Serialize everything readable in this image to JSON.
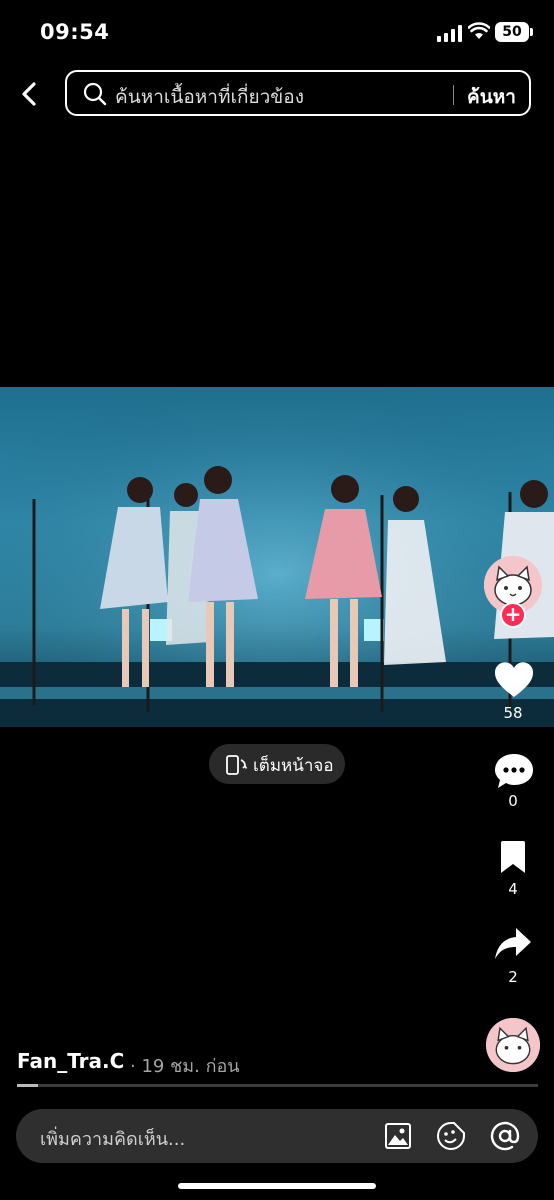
{
  "status_bar": {
    "time": "09:54",
    "battery": "50"
  },
  "search": {
    "placeholder": "ค้นหาเนื้อหาที่เกี่ยวข้อง",
    "button_label": "ค้นหา"
  },
  "video": {
    "fullscreen_label": "เต็มหน้าจอ",
    "progress": 0.04
  },
  "actions": {
    "likes": "58",
    "comments": "0",
    "saves": "4",
    "shares": "2"
  },
  "post": {
    "username": "Fan_Tra.C",
    "timestamp": "· 19 ชม. ก่อน"
  },
  "comment": {
    "placeholder": "เพิ่มความคิดเห็น..."
  },
  "icons": {
    "back": "chevron-left-icon",
    "search": "search-icon",
    "fullscreen": "rotate-phone-icon",
    "like": "heart-icon",
    "comment": "comment-bubble-icon",
    "save": "bookmark-icon",
    "share": "share-arrow-icon",
    "image": "image-icon",
    "emoji": "emoji-icon",
    "mention": "at-icon"
  },
  "colors": {
    "follow_badge": "#fe2c55",
    "background": "#000000"
  }
}
